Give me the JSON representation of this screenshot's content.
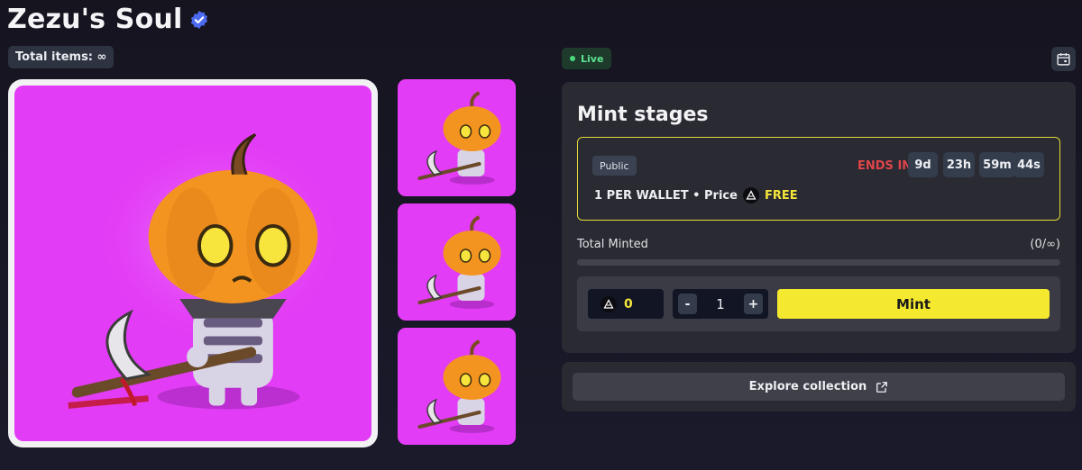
{
  "collection": {
    "name": "Zezu's Soul",
    "total_items_label": "Total items: ∞",
    "status": "Live"
  },
  "colors": {
    "accent_yellow": "#f5e92f",
    "art_background": "#e33cf6",
    "live_green": "#4bd97f",
    "ends_red": "#e0454a"
  },
  "icons": {
    "verified": "verified-badge-icon",
    "calendar": "calendar-icon",
    "coin": "apecoin-icon",
    "external": "external-link-icon"
  },
  "mint_stages": {
    "title": "Mint stages",
    "stage": {
      "tag": "Public",
      "ends_label": "ENDS IN",
      "countdown": [
        "9d",
        "23h",
        "59m",
        "44s"
      ],
      "limit_text": "1 PER WALLET • Price",
      "price": "FREE"
    },
    "total_minted_label": "Total Minted",
    "total_minted_value": "(0/∞)",
    "progress_fraction": 0,
    "cost_value": "0",
    "quantity": "1",
    "decrement_label": "-",
    "increment_label": "+",
    "mint_label": "Mint"
  },
  "explore": {
    "label": "Explore collection"
  }
}
